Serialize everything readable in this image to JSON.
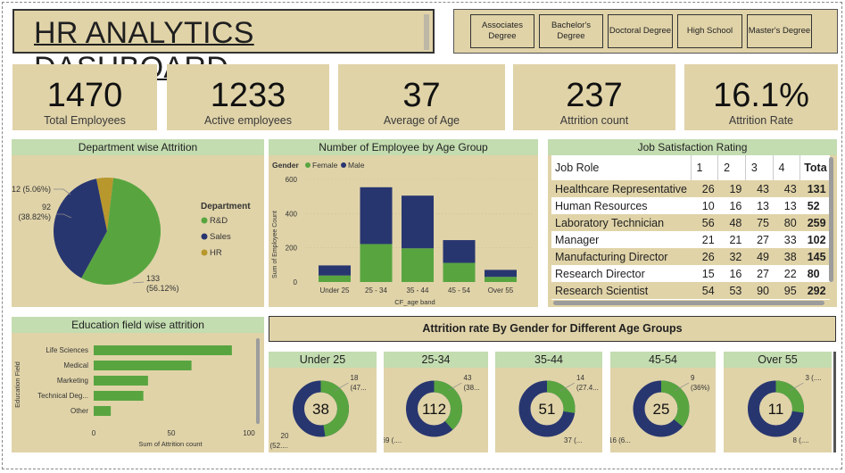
{
  "title": "HR ANALYTICS DASHBOARD",
  "education_slicer": [
    "Associates Degree",
    "Bachelor's Degree",
    "Doctoral Degree",
    "High School",
    "Master's Degree"
  ],
  "kpis": [
    {
      "value": "1470",
      "label": "Total Employees"
    },
    {
      "value": "1233",
      "label": "Active employees"
    },
    {
      "value": "37",
      "label": "Average of Age"
    },
    {
      "value": "237",
      "label": "Attrition count"
    },
    {
      "value": "16.1%",
      "label": "Attrition Rate"
    }
  ],
  "dept_attrition": {
    "title": "Department wise Attrition",
    "legend_title": "Department",
    "slices": [
      {
        "name": "R&D",
        "value": 133,
        "label": "133",
        "pct": "(56.12%)",
        "color": "#58a540"
      },
      {
        "name": "Sales",
        "value": 92,
        "label": "92",
        "pct": "(38.82%)",
        "color": "#283670"
      },
      {
        "name": "HR",
        "value": 12,
        "label": "12 (5.06%)",
        "pct": "",
        "color": "#b8972d"
      }
    ]
  },
  "age_group": {
    "title": "Number of Employee by Age Group",
    "legend_title": "Gender",
    "legend": [
      {
        "name": "Female",
        "color": "#58a540"
      },
      {
        "name": "Male",
        "color": "#283670"
      }
    ],
    "ylabel": "Sum of Employee Count",
    "xlabel": "CF_age band",
    "yticks": [
      "0",
      "200",
      "400",
      "600"
    ],
    "categories": [
      "Under 25",
      "25 - 34",
      "35 - 44",
      "45 - 54",
      "Over 55"
    ],
    "female": [
      38,
      222,
      197,
      112,
      30
    ],
    "male": [
      59,
      332,
      308,
      133,
      41
    ]
  },
  "job_satisfaction": {
    "title": "Job Satisfaction Rating",
    "headers": [
      "Job Role",
      "1",
      "2",
      "3",
      "4",
      "Tota"
    ],
    "rows": [
      [
        "Healthcare Representative",
        "26",
        "19",
        "43",
        "43",
        "131"
      ],
      [
        "Human Resources",
        "10",
        "16",
        "13",
        "13",
        "52"
      ],
      [
        "Laboratory Technician",
        "56",
        "48",
        "75",
        "80",
        "259"
      ],
      [
        "Manager",
        "21",
        "21",
        "27",
        "33",
        "102"
      ],
      [
        "Manufacturing Director",
        "26",
        "32",
        "49",
        "38",
        "145"
      ],
      [
        "Research Director",
        "15",
        "16",
        "27",
        "22",
        "80"
      ],
      [
        "Research Scientist",
        "54",
        "53",
        "90",
        "95",
        "292"
      ]
    ]
  },
  "education_attrition": {
    "title": "Education field wise attrition",
    "ylabel": "Education Field",
    "xlabel": "Sum of Attrition count",
    "xticks": [
      "0",
      "50",
      "100"
    ],
    "categories": [
      "Life Sciences",
      "Medical",
      "Marketing",
      "Technical Deg...",
      "Other"
    ],
    "values": [
      89,
      63,
      35,
      32,
      11
    ],
    "color": "#58a540"
  },
  "gender_attrition": {
    "title": "Attrition rate By Gender for Different Age Groups",
    "groups": [
      {
        "name": "Under 25",
        "total": "38",
        "female": 18,
        "male": 20,
        "f_lbl1": "18",
        "f_lbl2": "(47...",
        "m_lbl1": "20",
        "m_lbl2": "(52...."
      },
      {
        "name": "25-34",
        "total": "112",
        "female": 43,
        "male": 69,
        "f_lbl1": "43",
        "f_lbl2": "(38...",
        "m_lbl1": "69 (....",
        "m_lbl2": ""
      },
      {
        "name": "35-44",
        "total": "51",
        "female": 14,
        "male": 37,
        "f_lbl1": "14",
        "f_lbl2": "(27.4...",
        "m_lbl1": "37 (...",
        "m_lbl2": ""
      },
      {
        "name": "45-54",
        "total": "25",
        "female": 9,
        "male": 16,
        "f_lbl1": "9",
        "f_lbl2": "(36%)",
        "m_lbl1": "16 (6...",
        "m_lbl2": ""
      },
      {
        "name": "Over 55",
        "total": "11",
        "female": 3,
        "male": 8,
        "f_lbl1": "3 (....",
        "f_lbl2": "",
        "m_lbl1": "8 (....",
        "m_lbl2": ""
      }
    ],
    "colors": {
      "female": "#58a540",
      "male": "#283670"
    }
  },
  "chart_data": [
    {
      "type": "pie",
      "title": "Department wise Attrition",
      "categories": [
        "R&D",
        "Sales",
        "HR"
      ],
      "values": [
        133,
        92,
        12
      ],
      "legend": "right"
    },
    {
      "type": "bar",
      "title": "Number of Employee by Age Group",
      "categories": [
        "Under 25",
        "25 - 34",
        "35 - 44",
        "45 - 54",
        "Over 55"
      ],
      "series": [
        {
          "name": "Female",
          "values": [
            38,
            222,
            197,
            112,
            30
          ]
        },
        {
          "name": "Male",
          "values": [
            59,
            332,
            308,
            133,
            41
          ]
        }
      ],
      "stacked": true,
      "xlabel": "CF_age band",
      "ylabel": "Sum of Employee Count",
      "ylim": [
        0,
        650
      ]
    },
    {
      "type": "bar",
      "title": "Education field wise attrition",
      "orientation": "horizontal",
      "categories": [
        "Life Sciences",
        "Medical",
        "Marketing",
        "Technical Deg...",
        "Other"
      ],
      "values": [
        89,
        63,
        35,
        32,
        11
      ],
      "xlabel": "Sum of Attrition count",
      "ylabel": "Education Field",
      "xlim": [
        0,
        100
      ]
    }
  ]
}
